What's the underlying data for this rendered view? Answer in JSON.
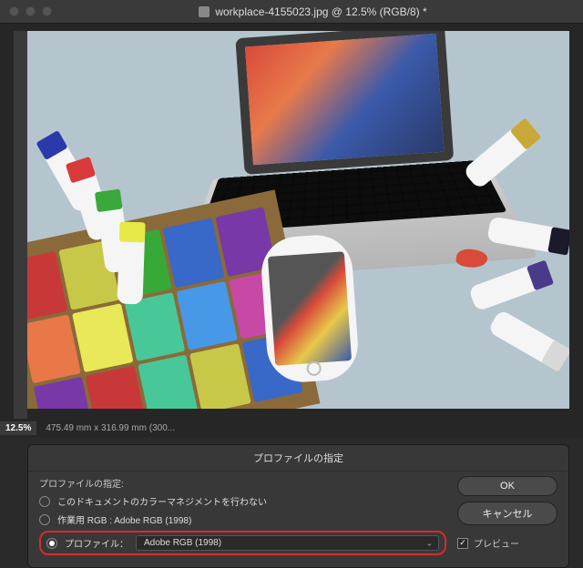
{
  "window": {
    "title": "workplace-4155023.jpg @ 12.5% (RGB/8) *"
  },
  "status": {
    "zoom": "12.5%",
    "dimensions": "475.49 mm x 316.99 mm (300..."
  },
  "dialog": {
    "title": "プロファイルの指定",
    "group_label": "プロファイルの指定:",
    "opt_none": "このドキュメントのカラーマネジメントを行わない",
    "opt_working": "作業用 RGB : Adobe RGB (1998)",
    "opt_profile_label": "プロファイル：",
    "profile_value": "Adobe RGB (1998)",
    "ok": "OK",
    "cancel": "キャンセル",
    "preview": "プレビュー"
  }
}
